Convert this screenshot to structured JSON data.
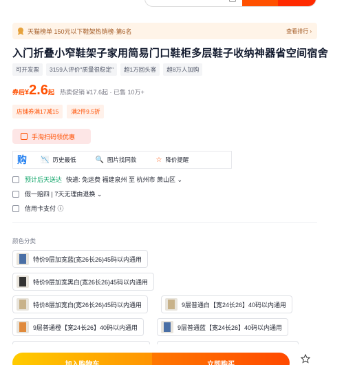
{
  "rank": {
    "text": "天猫榜单 150元以下鞋架热销榜·第6名",
    "more": "查看排行 ›"
  },
  "title": "入门折叠小窄鞋架子家用简易门口鞋柜多层鞋子收纳神器省空间宿舍",
  "tags": [
    "可开发票",
    "3159人评价\"质量很稳定\"",
    "超1万回头客",
    "超8万人加购"
  ],
  "price": {
    "prefix": "券后",
    "yen": "¥",
    "amount": "2.6",
    "suffix": "起",
    "note": "热卖促销 ¥17.6起 · 已售 10万+"
  },
  "coupons": [
    "店铺券满17减15",
    "满2件9.5折"
  ],
  "scan_button": "手淘扫码领优惠",
  "tools": {
    "gou": "购",
    "items": [
      {
        "icon": "📉",
        "label": "历史最低"
      },
      {
        "icon": "🔍",
        "label": "图片找同款"
      },
      {
        "icon": "☆",
        "label": "降价提醒"
      }
    ]
  },
  "shipping": {
    "green": "预计后天送达",
    "text": "快递: 免运费  福建泉州 至 杭州市 萧山区 ⌄"
  },
  "guarantee": {
    "text": "假一赔四 | 7天无理由退换 ⌄"
  },
  "payment": {
    "text": "信用卡支付 ⓘ"
  },
  "color_label": "颜色分类",
  "options": [
    {
      "label": "特价9层加宽蓝(宽26长26)45码以内通用",
      "color": "#4a6fa5"
    },
    {
      "label": "特价9层加宽黑白(宽26长26)45码以内通用",
      "color": "#333333"
    },
    {
      "label": "特价8层加宽白(宽26长26)45码以内通用",
      "color": "#c8b28a"
    },
    {
      "label": "9层普通白【宽24长26】40码以内通用",
      "color": "#c8b28a"
    },
    {
      "label": "9层普通橙【宽24长26】40码以内通用",
      "color": "#e08a3c"
    },
    {
      "label": "9层普通蓝【宽24长26】40码以内通用",
      "color": "#4a6fa5"
    }
  ],
  "bottom": {
    "cart": "加入购物车",
    "buy": "立即购买"
  },
  "colors": {
    "accent": "#ff5000",
    "green": "#11a56a",
    "blue": "#1e7df0"
  }
}
